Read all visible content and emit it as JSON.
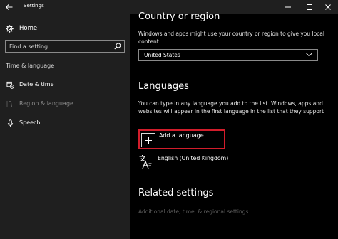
{
  "window": {
    "title": "Settings"
  },
  "sidebar": {
    "home_label": "Home",
    "search_placeholder": "Find a setting",
    "section_label": "Time & language",
    "items": [
      {
        "label": "Date & time"
      },
      {
        "label": "Region & language"
      },
      {
        "label": "Speech"
      }
    ]
  },
  "main": {
    "country_heading": "Country or region",
    "country_description": "Windows and apps might use your country or region to give you local content",
    "country_value": "United States",
    "languages_heading": "Languages",
    "languages_description": "You can type in any language you add to the list. Windows, apps and websites will appear in the first language in the list that they support",
    "add_language_label": "Add a language",
    "installed_languages": [
      "English (United Kingdom)"
    ],
    "related_heading": "Related settings",
    "related_link": "Additional date, time, & regional settings"
  },
  "colors": {
    "highlight_border": "#d21d2b",
    "sidebar_bg": "#1f1f1f",
    "main_bg": "#000000"
  }
}
